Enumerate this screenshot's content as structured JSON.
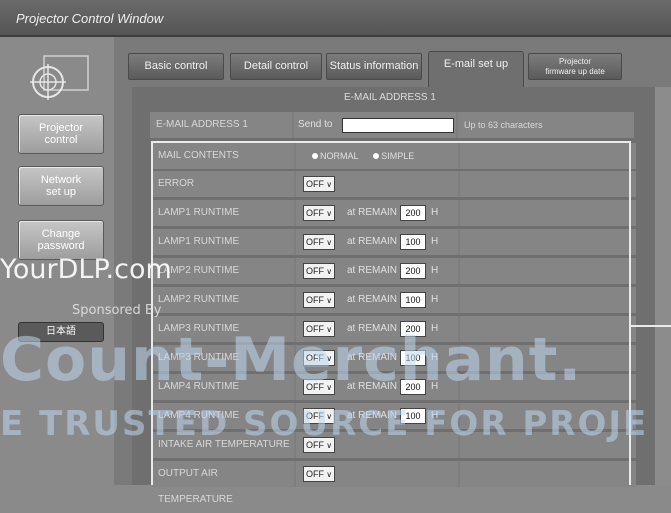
{
  "window": {
    "title": "Projector Control Window"
  },
  "sidebar": {
    "buttons": [
      "Projector\ncontrol",
      "Network\nset up",
      "Change\npassword"
    ],
    "language": "日本語"
  },
  "tabs": [
    {
      "label": "Basic control"
    },
    {
      "label": "Detail control"
    },
    {
      "label": "Status information"
    },
    {
      "label": "E-mail set up",
      "active": true
    },
    {
      "label": "Projector\nfirmware up date"
    }
  ],
  "section_title": "E-MAIL ADDRESS 1",
  "email_row": {
    "label": "E-MAIL ADDRESS 1",
    "send_to": "Send to",
    "hint": "Up to 63 characters"
  },
  "mail_contents": {
    "label": "MAIL CONTENTS",
    "options": [
      "NORMAL",
      "SIMPLE"
    ]
  },
  "rows": [
    {
      "label": "ERROR",
      "select": "OFF"
    },
    {
      "label": "LAMP1 RUNTIME",
      "select": "OFF",
      "at": "at REMAIN",
      "value": "200",
      "unit": "H"
    },
    {
      "label": "LAMP1 RUNTIME",
      "select": "OFF",
      "at": "at REMAIN",
      "value": "100",
      "unit": "H"
    },
    {
      "label": "LAMP2 RUNTIME",
      "select": "OFF",
      "at": "at REMAIN",
      "value": "200",
      "unit": "H"
    },
    {
      "label": "LAMP2 RUNTIME",
      "select": "OFF",
      "at": "at REMAIN",
      "value": "100",
      "unit": "H"
    },
    {
      "label": "LAMP3 RUNTIME",
      "select": "OFF",
      "at": "at REMAIN",
      "value": "200",
      "unit": "H"
    },
    {
      "label": "LAMP3 RUNTIME",
      "select": "OFF",
      "at": "at REMAIN",
      "value": "100",
      "unit": "H"
    },
    {
      "label": "LAMP4 RUNTIME",
      "select": "OFF",
      "at": "at REMAIN",
      "value": "200",
      "unit": "H"
    },
    {
      "label": "LAMP4 RUNTIME",
      "select": "OFF",
      "at": "at REMAIN",
      "value": "100",
      "unit": "H"
    },
    {
      "label": "INTAKE AIR TEMPERATURE",
      "select": "OFF"
    },
    {
      "label": "OUTPUT AIR TEMPERATURE",
      "select": "OFF"
    }
  ],
  "watermark": {
    "site": "YourDLP.com",
    "sponsor": "Sponsored By",
    "brand": "Count-Merchant.",
    "tagline": "E TRUSTED SOURCE FOR PROJE"
  },
  "colors": {
    "frame": "#eaeaea",
    "watermark": "#bed7f0"
  }
}
